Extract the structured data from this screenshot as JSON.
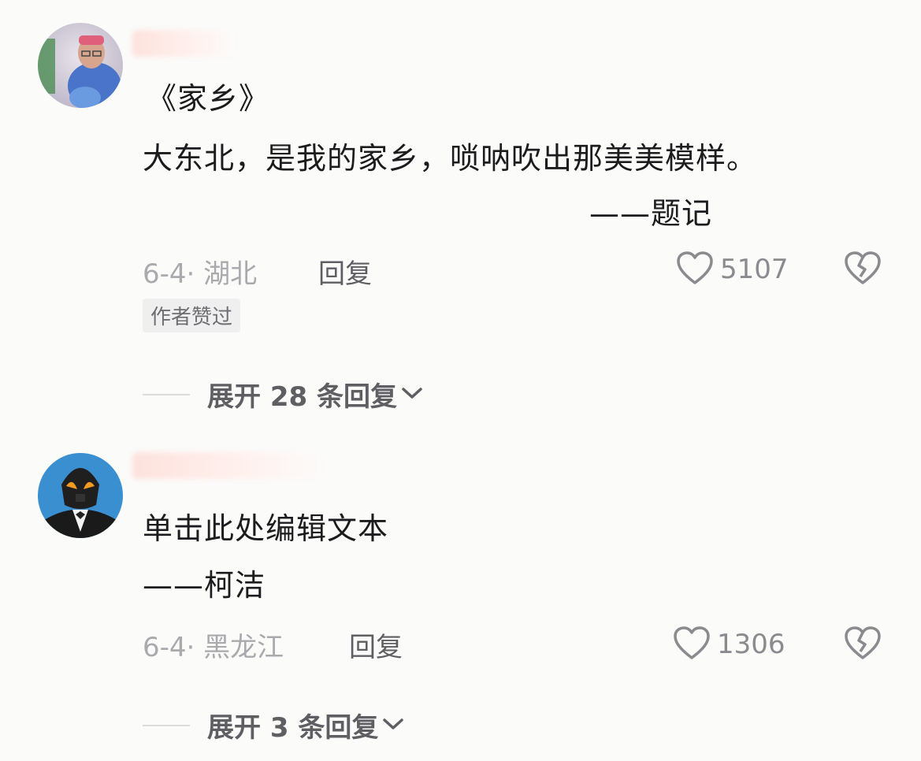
{
  "comments": [
    {
      "text_lines": [
        "《家乡》",
        "大东北，是我的家乡，唢呐吹出那美美模样。",
        "——题记"
      ],
      "date_location": "6-4· 湖北",
      "reply_label": "回复",
      "like_count": "5107",
      "badge": "作者赞过",
      "expand_label": "展开 28 条回复"
    },
    {
      "text_lines": [
        "单击此处编辑文本",
        "——柯洁"
      ],
      "date_location": "6-4· 黑龙江",
      "reply_label": "回复",
      "like_count": "1306",
      "expand_label": "展开 3 条回复"
    }
  ],
  "colors": {
    "background": "#fbfbfa",
    "primary_text": "#1c1c1e",
    "meta_text": "#a9a9ae",
    "reply_text": "#5e5e63",
    "badge_bg": "#efefef"
  },
  "icons": [
    "heart-icon",
    "broken-heart-icon",
    "chevron-down-icon"
  ]
}
